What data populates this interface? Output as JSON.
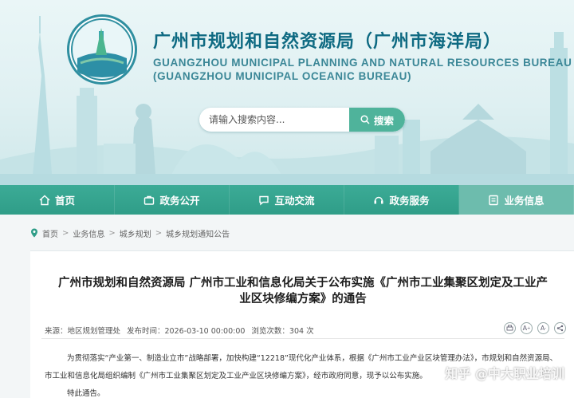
{
  "header": {
    "title_cn": "广州市规划和自然资源局（广州市海洋局）",
    "title_en_line1": "GUANGZHOU MUNICIPAL PLANNING AND NATURAL RESOURCES BUREAU",
    "title_en_line2": "(GUANGZHOU MUNICIPAL OCEANIC BUREAU)"
  },
  "search": {
    "placeholder": "请输入搜索内容...",
    "button_label": "搜索"
  },
  "nav": {
    "items": [
      {
        "label": "首页",
        "icon": "home-icon"
      },
      {
        "label": "政务公开",
        "icon": "briefcase-icon"
      },
      {
        "label": "互动交流",
        "icon": "chat-icon"
      },
      {
        "label": "政务服务",
        "icon": "service-icon"
      },
      {
        "label": "业务信息",
        "icon": "book-icon"
      }
    ],
    "active_index": 4
  },
  "breadcrumb": {
    "items": [
      "首页",
      "业务信息",
      "城乡规划",
      "城乡规划通知公告"
    ]
  },
  "article": {
    "title": "广州市规划和自然资源局 广州市工业和信息化局关于公布实施《广州市工业集聚区划定及工业产业区块修编方案》的通告",
    "source": "来源：地区规划管理处",
    "publish_time": "发布时间：2026-03-10 00:00:00",
    "views": "浏览次数：304 次",
    "body_line1": "为贯彻落实“产业第一、制造业立市”战略部署，加快构建“12218”现代化产业体系，根据《广州市工业产业区块管理办法》，市规划和自然资源局、",
    "body_line2": "市工业和信息化局组织编制《广州市工业集聚区划定及工业产业区块修编方案》，经市政府同意，现予以公布实施。",
    "body_line3": "特此通告。"
  },
  "watermark": "知乎 @中大职业培训",
  "colors": {
    "nav": "#35a590",
    "nav_active": "#6dbcad",
    "title": "#0e6a82",
    "search_button": "#4fb39b"
  }
}
